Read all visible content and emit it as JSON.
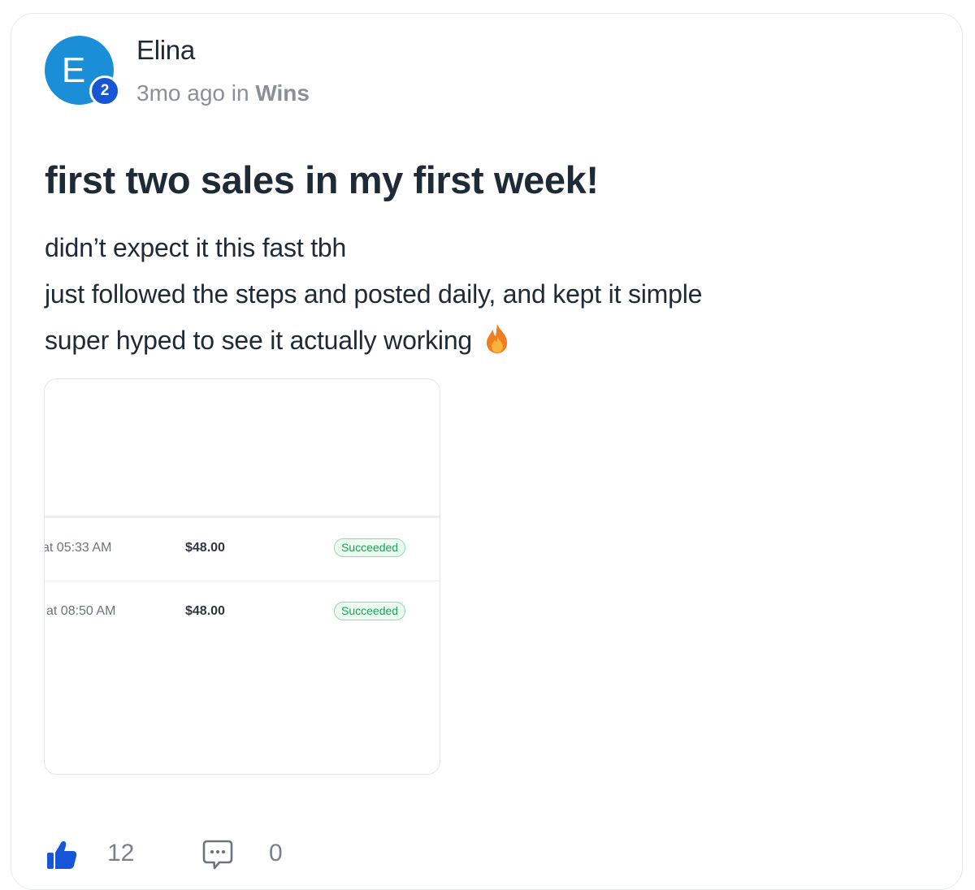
{
  "post": {
    "author": {
      "initial": "E",
      "name": "Elina",
      "level": "2",
      "avatar_color": "#1a8fd8",
      "badge_color": "#1555d6"
    },
    "meta": {
      "time_prefix": "3mo ago in ",
      "category": "Wins"
    },
    "title": "first two sales in my first week!",
    "body": {
      "lines": [
        "didn’t expect it this fast tbh",
        "just followed the steps and posted daily, and kept it simple",
        "super hyped to see it actually working"
      ],
      "trailing_icon": "flame-icon"
    },
    "attachment": {
      "transactions": [
        {
          "time": "at 05:33 AM",
          "amount": "$48.00",
          "status": "Succeeded"
        },
        {
          "time": "at 08:50 AM",
          "amount": "$48.00",
          "status": "Succeeded"
        }
      ],
      "status_color": "#1e9f52"
    },
    "actions": {
      "like_icon": "thumbs-up-icon",
      "like_count": "12",
      "comment_icon": "comment-icon",
      "comment_count": "0",
      "accent_color": "#1555d6"
    }
  }
}
